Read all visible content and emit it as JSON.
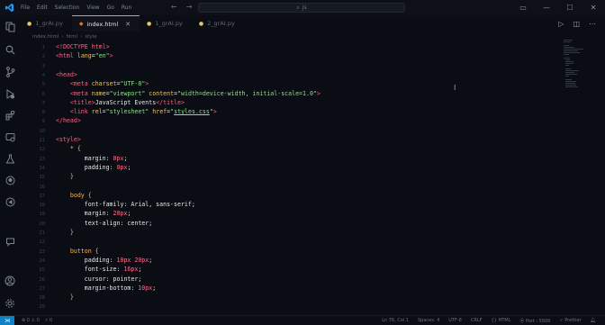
{
  "menu": [
    "File",
    "Edit",
    "Selection",
    "View",
    "Go",
    "Run"
  ],
  "search_placeholder": "js",
  "tabs": [
    {
      "label": "1_grAI.py",
      "active": false
    },
    {
      "label": "index.html",
      "active": true
    },
    {
      "label": "1_grAI.py",
      "active": false
    },
    {
      "label": "2_grAI.py",
      "active": false
    }
  ],
  "breadcrumb": [
    "index.html",
    "html",
    "style"
  ],
  "code": [
    {
      "n": "1",
      "html": "<span class='tag'>&lt;!DOCTYPE html&gt;</span>"
    },
    {
      "n": "2",
      "html": "<span class='tag'>&lt;html</span> <span class='attr'>lang</span><span class='pun'>=</span><span class='str'>\"en\"</span><span class='tag'>&gt;</span>"
    },
    {
      "n": "3",
      "html": ""
    },
    {
      "n": "4",
      "html": "<span class='tag'>&lt;head&gt;</span>"
    },
    {
      "n": "5",
      "html": "    <span class='tag'>&lt;meta</span> <span class='attr'>charset</span><span class='pun'>=</span><span class='str'>\"UTF-8\"</span><span class='tag'>&gt;</span>"
    },
    {
      "n": "6",
      "html": "    <span class='tag'>&lt;meta</span> <span class='attr'>name</span><span class='pun'>=</span><span class='str'>\"viewport\"</span> <span class='attr'>content</span><span class='pun'>=</span><span class='str'>\"width=device-width, initial-scale=1.0\"</span><span class='tag'>&gt;</span>"
    },
    {
      "n": "7",
      "html": "    <span class='tag'>&lt;title&gt;</span><span class='txt'>JavaScript Events</span><span class='tag'>&lt;/title&gt;</span>"
    },
    {
      "n": "8",
      "html": "    <span class='tag'>&lt;link</span> <span class='attr'>rel</span><span class='pun'>=</span><span class='str'>\"stylesheet\"</span> <span class='attr'>href</span><span class='pun'>=</span><span class='str'>\"<span class='link-u'>styles.css</span>\"</span><span class='tag'>&gt;</span>"
    },
    {
      "n": "9",
      "html": "<span class='tag'>&lt;/head&gt;</span>"
    },
    {
      "n": "10",
      "html": ""
    },
    {
      "n": "11",
      "html": "<span class='tag'>&lt;style&gt;</span>"
    },
    {
      "n": "12",
      "html": "    <span class='sel'>* {</span>"
    },
    {
      "n": "13",
      "html": "        <span class='prop'>margin</span><span class='pun'>: </span><span class='val'>0px</span><span class='pun'>;</span>"
    },
    {
      "n": "14",
      "html": "        <span class='prop'>padding</span><span class='pun'>: </span><span class='val'>0px</span><span class='pun'>;</span>"
    },
    {
      "n": "15",
      "html": "    <span class='sel'>}</span>"
    },
    {
      "n": "16",
      "html": ""
    },
    {
      "n": "17",
      "html": "    <span class='sel'>body {</span>"
    },
    {
      "n": "18",
      "html": "        <span class='prop'>font-family</span><span class='pun'>: Arial, sans-serif;</span>"
    },
    {
      "n": "19",
      "html": "        <span class='prop'>margin</span><span class='pun'>: </span><span class='val'>20px</span><span class='pun'>;</span>"
    },
    {
      "n": "20",
      "html": "        <span class='prop'>text-align</span><span class='pun'>: center;</span>"
    },
    {
      "n": "21",
      "html": "    <span class='sel'>}</span>"
    },
    {
      "n": "22",
      "html": ""
    },
    {
      "n": "23",
      "html": "    <span class='sel'>button {</span>"
    },
    {
      "n": "24",
      "html": "        <span class='prop'>padding</span><span class='pun'>: </span><span class='val'>10px 20px</span><span class='pun'>;</span>"
    },
    {
      "n": "25",
      "html": "        <span class='prop'>font-size</span><span class='pun'>: </span><span class='val'>16px</span><span class='pun'>;</span>"
    },
    {
      "n": "26",
      "html": "        <span class='prop'>cursor</span><span class='pun'>: pointer;</span>"
    },
    {
      "n": "27",
      "html": "        <span class='prop'>margin-bottom</span><span class='pun'>: </span><span class='val'>10px</span><span class='pun'>;</span>"
    },
    {
      "n": "28",
      "html": "    <span class='sel'>}</span>"
    },
    {
      "n": "29",
      "html": ""
    }
  ],
  "status": {
    "left": [
      "⊗ 0 ⚠ 0",
      "⚡ 0"
    ],
    "cursor": "Ln 76, Col 1",
    "spaces": "Spaces: 4",
    "encoding": "UTF-8",
    "eol": "CRLF",
    "language": "{} HTML",
    "port": "⦿ Port : 5500",
    "prettier": "✓ Prettier"
  }
}
